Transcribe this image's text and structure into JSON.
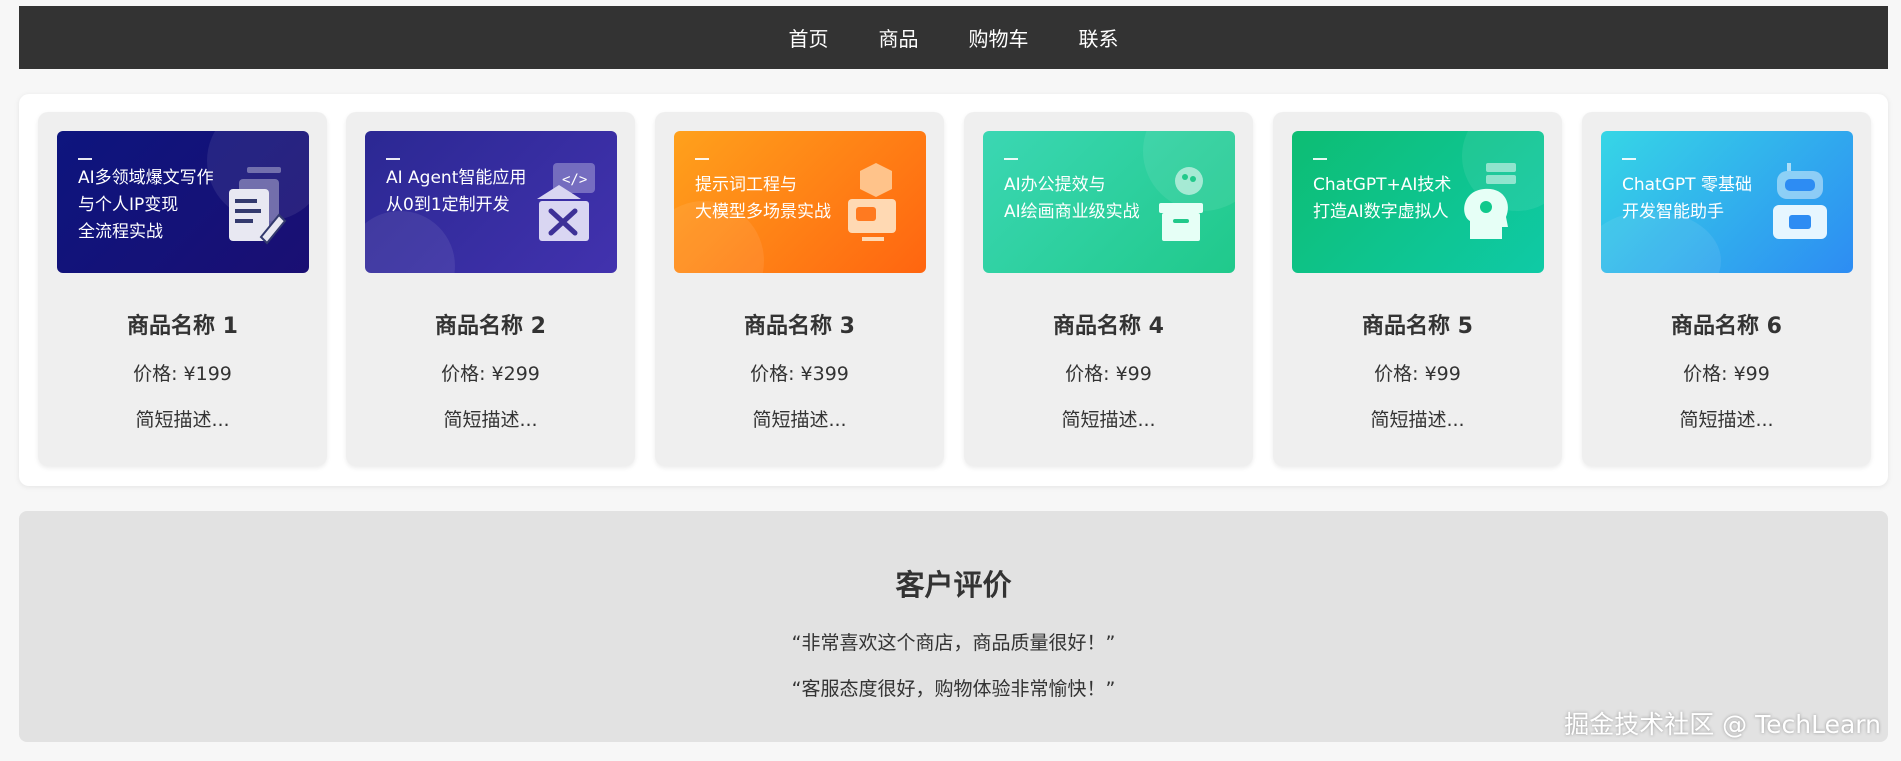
{
  "nav": {
    "items": [
      "首页",
      "商品",
      "购物车",
      "联系"
    ]
  },
  "products": [
    {
      "banner_lines": [
        "AI多领域爆文写作",
        "与个人IP变现",
        "全流程实战"
      ],
      "banner_colors": [
        "#0f1580",
        "#14107a"
      ],
      "icon": "document-pen-icon",
      "title": "商品名称 1",
      "price": "价格: ¥199",
      "desc": "简短描述..."
    },
    {
      "banner_lines": [
        "AI Agent智能应用",
        "从0到1定制开发"
      ],
      "banner_colors": [
        "#2e2a9a",
        "#3a2ea8"
      ],
      "icon": "toolbox-icon",
      "title": "商品名称 2",
      "price": "价格: ¥299",
      "desc": "简短描述..."
    },
    {
      "banner_lines": [
        "提示词工程与",
        "大模型多场景实战"
      ],
      "banner_colors": [
        "#ff9a1a",
        "#ff6a10"
      ],
      "icon": "chat-monitor-icon",
      "title": "商品名称 3",
      "price": "价格: ¥399",
      "desc": "简短描述..."
    },
    {
      "banner_lines": [
        "AI办公提效与",
        "AI绘画商业级实战"
      ],
      "banner_colors": [
        "#3ad6b0",
        "#22c98a"
      ],
      "icon": "palette-box-icon",
      "title": "商品名称 4",
      "price": "价格: ¥99",
      "desc": "简短描述..."
    },
    {
      "banner_lines": [
        "ChatGPT+AI技术",
        "打造AI数字虚拟人"
      ],
      "banner_colors": [
        "#0fc07a",
        "#10c9a0"
      ],
      "icon": "head-chip-icon",
      "title": "商品名称 5",
      "price": "价格: ¥99",
      "desc": "简短描述..."
    },
    {
      "banner_lines": [
        "ChatGPT 零基础",
        "开发智能助手"
      ],
      "banner_colors": [
        "#2fd2e8",
        "#2f8cf5"
      ],
      "icon": "robot-chat-icon",
      "title": "商品名称 6",
      "price": "价格: ¥99",
      "desc": "简短描述..."
    }
  ],
  "reviews": {
    "title": "客户评价",
    "items": [
      "“非常喜欢这个商店，商品质量很好！”",
      "“客服态度很好，购物体验非常愉快！”"
    ]
  },
  "watermark": "掘金技术社区 @ TechLearn"
}
